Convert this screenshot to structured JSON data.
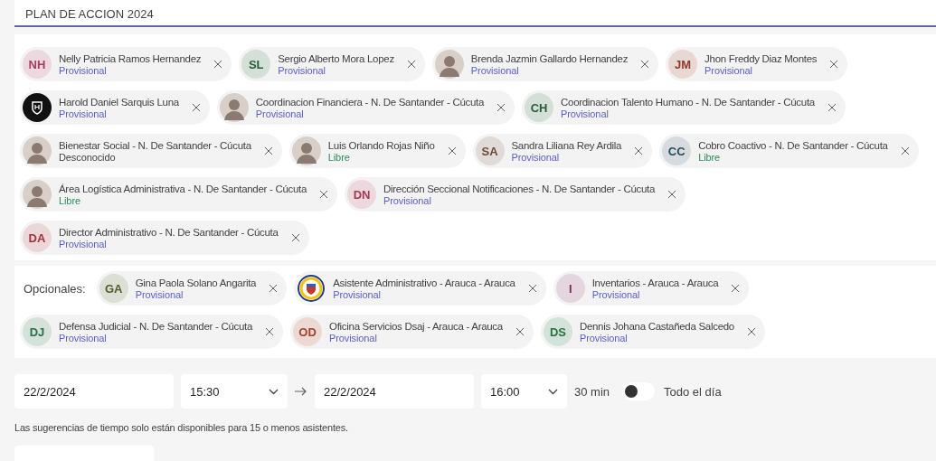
{
  "title_field": {
    "value": "PLAN DE ACCION 2024"
  },
  "required_attendees": {
    "rows": [
      [
        {
          "name": "Nelly Patricia Ramos Hernandez",
          "status": "Provisional",
          "color": "#5b5fc7",
          "avatar": {
            "kind": "initials",
            "initials": "NH",
            "color": "#a33e5f"
          }
        },
        {
          "name": "Sergio Alberto Mora Lopez",
          "status": "Provisional",
          "color": "#5b5fc7",
          "avatar": {
            "kind": "initials",
            "initials": "SL",
            "color": "#275e37"
          }
        },
        {
          "name": "Brenda Jazmin Gallardo Hernandez",
          "status": "Provisional",
          "color": "#5b5fc7",
          "avatar": {
            "kind": "photo"
          }
        },
        {
          "name": "Jhon Freddy Diaz Montes",
          "status": "Provisional",
          "color": "#5b5fc7",
          "avatar": {
            "kind": "initials",
            "initials": "JM",
            "color": "#8c3a25"
          }
        }
      ],
      [
        {
          "name": "Harold Daniel Sarquis Luna",
          "status": "Provisional",
          "color": "#5b5fc7",
          "avatar": {
            "kind": "logo"
          }
        },
        {
          "name": "Coordinacion Financiera - N. De Santander - Cúcuta",
          "status": "Provisional",
          "color": "#5b5fc7",
          "avatar": {
            "kind": "photo"
          }
        },
        {
          "name": "Coordinacion Talento Humano - N. De Santander - Cúcuta",
          "status": "Provisional",
          "color": "#5b5fc7",
          "avatar": {
            "kind": "initials",
            "initials": "CH",
            "color": "#275e37"
          }
        }
      ],
      [
        {
          "name": "Bienestar Social - N. De Santander - Cúcuta",
          "status": "Desconocido",
          "color": "#424242",
          "avatar": {
            "kind": "photo"
          }
        },
        {
          "name": "Luis Orlando Rojas Niño",
          "status": "Libre",
          "color": "#2e8b57",
          "avatar": {
            "kind": "photo"
          }
        },
        {
          "name": "Sandra Liliana Rey Ardila",
          "status": "Provisional",
          "color": "#5b5fc7",
          "avatar": {
            "kind": "initials",
            "initials": "SA",
            "color": "#6b4a3c"
          }
        },
        {
          "name": "Cobro Coactivo - N. De Santander - Cúcuta",
          "status": "Libre",
          "color": "#2e8b57",
          "avatar": {
            "kind": "initials",
            "initials": "CC",
            "color": "#2b4b5b"
          }
        }
      ],
      [
        {
          "name": "Área Logística Administrativa - N. De Santander - Cúcuta",
          "status": "Libre",
          "color": "#2e8b57",
          "avatar": {
            "kind": "photo"
          }
        },
        {
          "name": "Dirección Seccional Notificaciones - N. De Santander - Cúcuta",
          "status": "Provisional",
          "color": "#5b5fc7",
          "avatar": {
            "kind": "initials",
            "initials": "DN",
            "color": "#a13a55"
          }
        }
      ],
      [
        {
          "name": "Director Administrativo - N. De Santander - Cúcuta",
          "status": "Provisional",
          "color": "#5b5fc7",
          "avatar": {
            "kind": "initials",
            "initials": "DA",
            "color": "#a0343d"
          }
        }
      ]
    ]
  },
  "optional_attendees": {
    "label": "Opcionales:",
    "rows": [
      [
        {
          "name": "Gina Paola Solano Angarita",
          "status": "Provisional",
          "color": "#5b5fc7",
          "avatar": {
            "kind": "initials",
            "initials": "GA",
            "color": "#4d5e26"
          }
        },
        {
          "name": "Asistente Administrativo - Arauca - Arauca",
          "status": "Provisional",
          "color": "#5b5fc7",
          "avatar": {
            "kind": "emblem"
          }
        },
        {
          "name": "Inventarios - Arauca - Arauca",
          "status": "Provisional",
          "color": "#5b5fc7",
          "avatar": {
            "kind": "initials",
            "initials": "I",
            "color": "#7a2e5c"
          }
        }
      ],
      [
        {
          "name": "Defensa Judicial - N. De Santander - Cúcuta",
          "status": "Provisional",
          "color": "#5b5fc7",
          "avatar": {
            "kind": "initials",
            "initials": "DJ",
            "color": "#287048"
          }
        },
        {
          "name": "Oficina Servicios Dsaj - Arauca - Arauca",
          "status": "Provisional",
          "color": "#5b5fc7",
          "avatar": {
            "kind": "initials",
            "initials": "OD",
            "color": "#a6402a"
          }
        },
        {
          "name": "Dennis Johana Castañeda Salcedo",
          "status": "Provisional",
          "color": "#5b5fc7",
          "avatar": {
            "kind": "initials",
            "initials": "DS",
            "color": "#26733f"
          }
        }
      ]
    ]
  },
  "schedule": {
    "start_date": "22/2/2024",
    "start_time": "15:30",
    "end_date": "22/2/2024",
    "end_time": "16:00",
    "duration": "30 min",
    "all_day": {
      "label": "Todo el día",
      "on": false
    }
  },
  "hint": "Las sugerencias de tiempo solo están disponibles para 15 o menos asistentes."
}
